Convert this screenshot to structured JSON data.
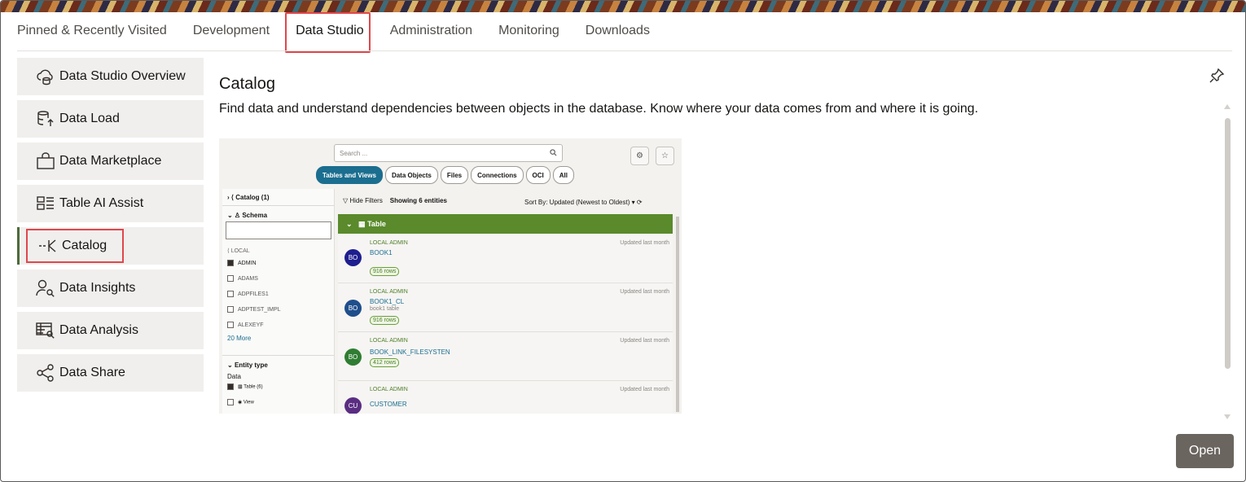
{
  "tabs": [
    {
      "label": "Pinned & Recently Visited"
    },
    {
      "label": "Development"
    },
    {
      "label": "Data Studio"
    },
    {
      "label": "Administration"
    },
    {
      "label": "Monitoring"
    },
    {
      "label": "Downloads"
    }
  ],
  "active_tab": "Data Studio",
  "sidebar": {
    "items": [
      {
        "label": "Data Studio Overview",
        "icon": "cloud-database-icon"
      },
      {
        "label": "Data Load",
        "icon": "database-upload-icon"
      },
      {
        "label": "Data Marketplace",
        "icon": "shopping-bag-icon"
      },
      {
        "label": "Table AI Assist",
        "icon": "table-list-icon"
      },
      {
        "label": "Catalog",
        "icon": "catalog-icon"
      },
      {
        "label": "Data Insights",
        "icon": "person-search-icon"
      },
      {
        "label": "Data Analysis",
        "icon": "table-search-icon"
      },
      {
        "label": "Data Share",
        "icon": "share-icon"
      }
    ],
    "active": "Catalog"
  },
  "detail": {
    "title": "Catalog",
    "description": "Find data and understand dependencies between objects in the database. Know where your data comes from and where it is going.",
    "open_label": "Open"
  },
  "preview": {
    "search_placeholder": "Search ...",
    "chips": [
      "Tables and Views",
      "Data Objects",
      "Files",
      "Connections",
      "OCI",
      "All"
    ],
    "left": {
      "catalog": "Catalog (1)",
      "schema": "Schema",
      "local": "LOCAL",
      "schemas": [
        "ADMIN",
        "ADAMS",
        "ADPFILES1",
        "ADPTEST_IMPL",
        "ALEXEYF"
      ],
      "more": "20 More",
      "entity_type": "Entity type",
      "data": "Data",
      "table": "Table (6)",
      "view": "View"
    },
    "hide_filters": "Hide Filters",
    "showing": "Showing 6 entities",
    "sort": "Sort By: Updated (Newest to Oldest)",
    "table_header": "Table",
    "items": [
      {
        "initials": "BO",
        "color": "#1e1e8f",
        "name": "BOOK1",
        "sub": "",
        "rows": "916 rows",
        "meta": "LOCAL  ADMIN",
        "updated": "Updated last month"
      },
      {
        "initials": "BO",
        "color": "#1f4e8c",
        "name": "BOOK1_CL",
        "sub": "book1 table",
        "rows": "916 rows",
        "meta": "LOCAL  ADMIN",
        "updated": "Updated last month"
      },
      {
        "initials": "BO",
        "color": "#2f7d32",
        "name": "BOOK_LINK_FILESYSTEN",
        "sub": "",
        "rows": "412 rows",
        "meta": "LOCAL  ADMIN",
        "updated": "Updated last month"
      },
      {
        "initials": "CU",
        "color": "#5a2d82",
        "name": "CUSTOMER",
        "sub": "",
        "rows": "",
        "meta": "LOCAL  ADMIN",
        "updated": "Updated last month"
      }
    ]
  }
}
